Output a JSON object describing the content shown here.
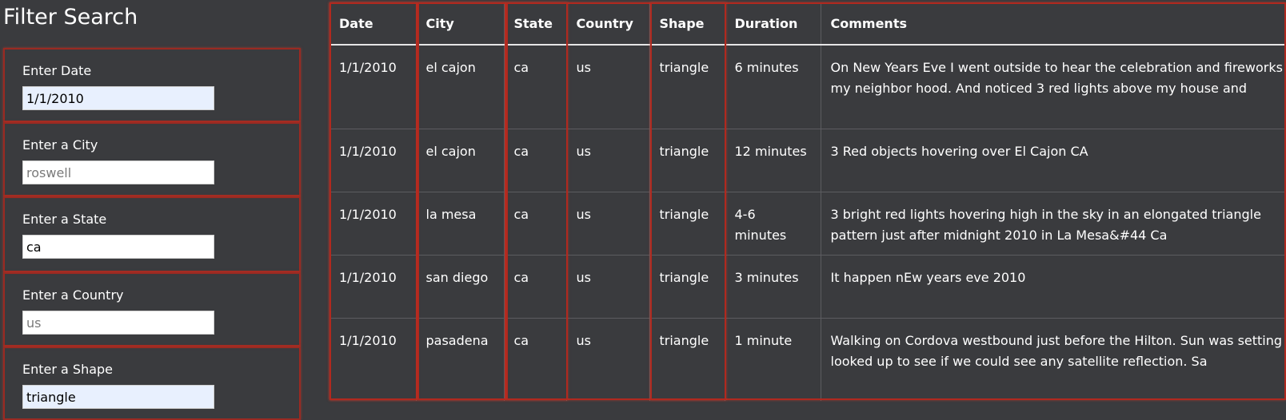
{
  "sidebar": {
    "title": "Filter Search",
    "filters": [
      {
        "label": "Enter Date",
        "value": "1/1/2010",
        "placeholder": ""
      },
      {
        "label": "Enter a City",
        "value": "",
        "placeholder": "roswell"
      },
      {
        "label": "Enter a State",
        "value": "ca",
        "placeholder": ""
      },
      {
        "label": "Enter a Country",
        "value": "",
        "placeholder": "us"
      },
      {
        "label": "Enter a Shape",
        "value": "triangle",
        "placeholder": ""
      }
    ]
  },
  "table": {
    "headers": [
      "Date",
      "City",
      "State",
      "Country",
      "Shape",
      "Duration",
      "Comments"
    ],
    "rows": [
      [
        "1/1/2010",
        "el cajon",
        "ca",
        "us",
        "triangle",
        "6 minutes",
        "On New Years Eve I went outside to hear the celebration and fireworks in my neighbor hood. And noticed 3 red lights above my house and"
      ],
      [
        "1/1/2010",
        "el cajon",
        "ca",
        "us",
        "triangle",
        "12 minutes",
        "3 Red objects hovering over El Cajon CA"
      ],
      [
        "1/1/2010",
        "la mesa",
        "ca",
        "us",
        "triangle",
        "4-6 minutes",
        "3 bright red lights hovering high in the sky in an elongated triangle pattern just after midnight 2010 in La Mesa&#44 Ca"
      ],
      [
        "1/1/2010",
        "san diego",
        "ca",
        "us",
        "triangle",
        "3 minutes",
        "It happen nEw years eve 2010"
      ],
      [
        "1/1/2010",
        "pasadena",
        "ca",
        "us",
        "triangle",
        "1 minute",
        "Walking on Cordova westbound just before the Hilton. Sun was setting so looked up to see if we could see any satellite reflection. Sa"
      ]
    ]
  },
  "colors": {
    "background": "#3a3b3e",
    "highlight": "#b0291f",
    "text": "#ffffff"
  }
}
